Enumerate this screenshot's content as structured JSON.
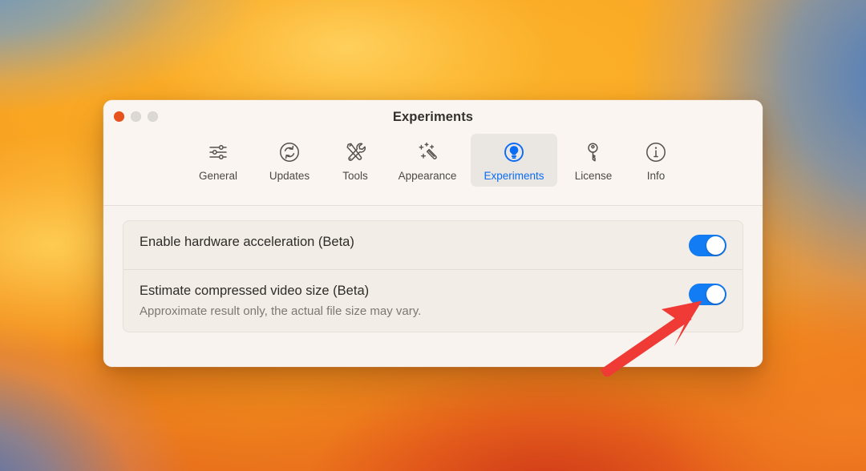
{
  "window": {
    "title": "Experiments",
    "traffic_lights": [
      {
        "name": "close",
        "color": "#E8521C"
      },
      {
        "name": "minimize",
        "color": "#DCD8D3"
      },
      {
        "name": "maximize",
        "color": "#DCD8D3"
      }
    ]
  },
  "toolbar": {
    "selected": "Experiments",
    "accent_color": "#0A6CF5",
    "tabs": [
      {
        "label": "General",
        "icon": "sliders-icon",
        "selected": false
      },
      {
        "label": "Updates",
        "icon": "refresh-circle-icon",
        "selected": false
      },
      {
        "label": "Tools",
        "icon": "tools-icon",
        "selected": false
      },
      {
        "label": "Appearance",
        "icon": "magic-wand-icon",
        "selected": false
      },
      {
        "label": "Experiments",
        "icon": "lightbulb-circle-icon",
        "selected": true
      },
      {
        "label": "License",
        "icon": "key-icon",
        "selected": false
      },
      {
        "label": "Info",
        "icon": "info-circle-icon",
        "selected": false
      }
    ]
  },
  "settings": {
    "rows": [
      {
        "title": "Enable hardware acceleration (Beta)",
        "subtitle": "",
        "toggle_state": "on"
      },
      {
        "title": "Estimate compressed video size (Beta)",
        "subtitle": "Approximate result only, the actual file size may vary.",
        "toggle_state": "on"
      }
    ]
  },
  "annotation": {
    "type": "arrow",
    "color": "#F03A35",
    "points_to": "Estimate compressed video size toggle"
  },
  "desktop": {
    "wallpaper": "abstract-orange-blue-gradient"
  }
}
